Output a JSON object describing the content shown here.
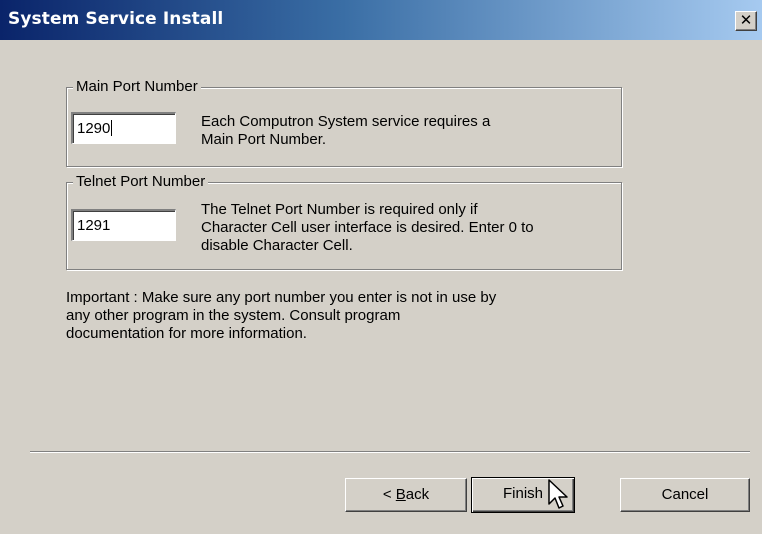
{
  "window": {
    "title": "System Service Install",
    "close_glyph": "✕"
  },
  "main_port": {
    "legend": "Main Port Number",
    "value": "1290",
    "description_line1": "Each Computron System service requires a",
    "description_line2": "Main Port Number."
  },
  "telnet_port": {
    "legend": "Telnet Port Number",
    "value": "1291",
    "description_line1": "The Telnet Port Number is required only if",
    "description_line2": "Character Cell user interface is desired. Enter 0 to",
    "description_line3": "disable Character Cell."
  },
  "important": {
    "line1": "Important : Make sure any port number you enter is not in use by",
    "line2": "any other program in the system.  Consult program",
    "line3": "documentation for more information."
  },
  "buttons": {
    "back_prefix": "< ",
    "back_mnemonic": "B",
    "back_rest": "ack",
    "finish": "Finish",
    "cancel": "Cancel"
  },
  "colors": {
    "title_start": "#0a246a",
    "title_end": "#a6caf0",
    "dialog_bg": "#d4d0c8"
  },
  "icons": {
    "close": "close-icon",
    "cursor": "mouse-pointer-icon"
  }
}
